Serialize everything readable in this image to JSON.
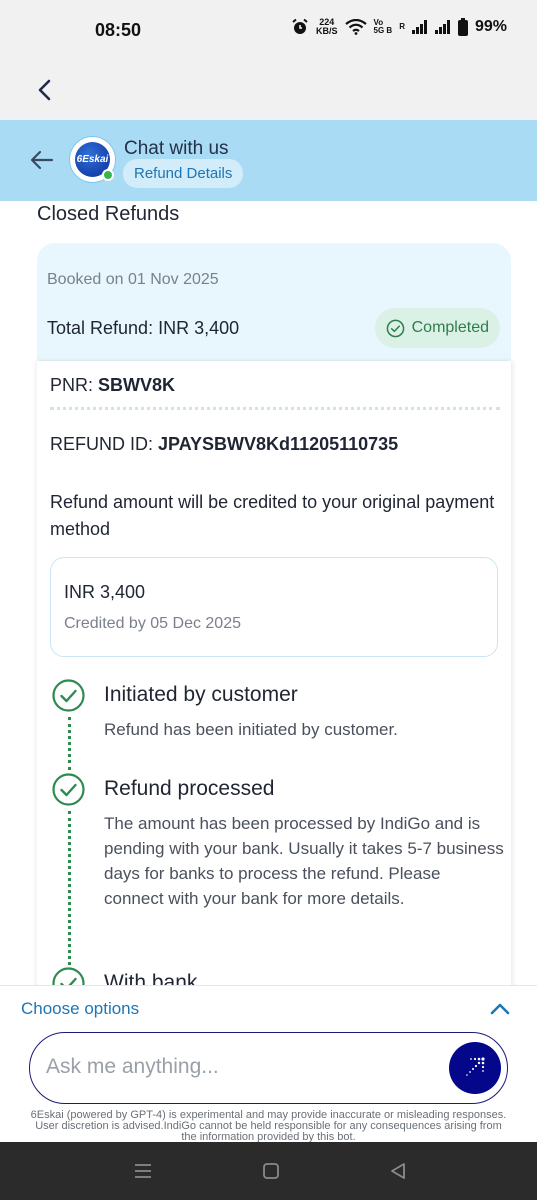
{
  "status_bar": {
    "time": "08:50",
    "net_speed_top": "224",
    "net_speed_bottom": "KB/S",
    "volte_top": "Vo",
    "volte_bottom": "5G B",
    "roaming": "R",
    "battery": "99%"
  },
  "header": {
    "title": "Chat with us",
    "subtitle": "Refund Details",
    "avatar_text": "6Eskai"
  },
  "refunds": {
    "section_title": "Closed Refunds",
    "booked_on": "Booked on 01 Nov 2025",
    "total_refund": "Total Refund: INR 3,400",
    "status": "Completed",
    "pnr_label": "PNR:",
    "pnr_value": "SBWV8K",
    "refund_id_label": "REFUND ID:",
    "refund_id_value": "JPAYSBWV8Kd11205110735",
    "credit_note": "Refund amount will be credited to your original payment method",
    "amount": "INR 3,400",
    "credited_by": "Credited by 05 Dec 2025",
    "steps": [
      {
        "title": "Initiated by customer",
        "description": "Refund has been initiated by customer."
      },
      {
        "title": "Refund processed",
        "description": "The amount has been processed by IndiGo and is pending with your bank. Usually it takes 5-7 business days for banks to process the refund. Please connect with your bank for more details."
      },
      {
        "title": "With bank",
        "description": ""
      }
    ]
  },
  "options": {
    "label": "Choose options"
  },
  "input": {
    "placeholder": "Ask me anything..."
  },
  "disclaimer": "6Eskai (powered by GPT-4) is experimental and may provide inaccurate or misleading responses. User discretion is advised.IndiGo cannot be held responsible for any consequences arising from the information provided by this bot.",
  "colors": {
    "header_bg": "#a9dcf4",
    "accent_blue": "#1d76b6",
    "send_button": "#04078a",
    "success_green": "#2e8b4f",
    "card_tint": "#e8f6fd"
  }
}
